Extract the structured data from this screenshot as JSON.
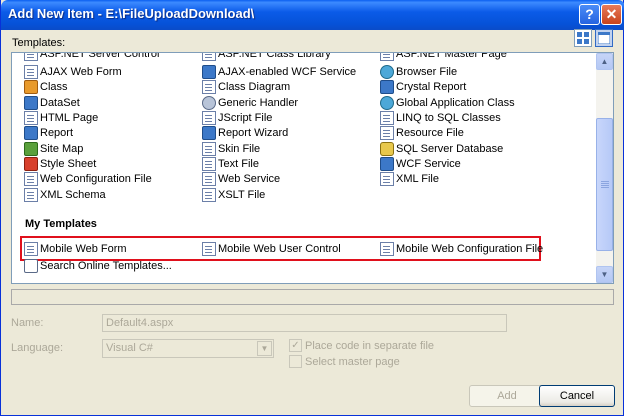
{
  "window": {
    "title": "Add New Item - E:\\FileUploadDownload\\"
  },
  "templates_label": "Templates:",
  "vs_templates": {
    "col1": [
      {
        "label": "ASP.NET Server Control",
        "icon": "page-icon"
      },
      {
        "label": "AJAX Web Form",
        "icon": "ajax-form-icon"
      },
      {
        "label": "Class",
        "icon": "class-icon"
      },
      {
        "label": "DataSet",
        "icon": "dataset-icon"
      },
      {
        "label": "HTML Page",
        "icon": "html-page-icon"
      },
      {
        "label": "Report",
        "icon": "report-icon"
      },
      {
        "label": "Site Map",
        "icon": "sitemap-icon"
      },
      {
        "label": "Style Sheet",
        "icon": "stylesheet-icon"
      },
      {
        "label": "Web Configuration File",
        "icon": "webconfig-icon"
      },
      {
        "label": "XML Schema",
        "icon": "xml-schema-icon"
      }
    ],
    "col2": [
      {
        "label": "ASP.NET Class Library",
        "icon": "page-icon"
      },
      {
        "label": "AJAX-enabled WCF Service",
        "icon": "wcf-icon"
      },
      {
        "label": "Class Diagram",
        "icon": "class-diagram-icon"
      },
      {
        "label": "Generic Handler",
        "icon": "handler-icon"
      },
      {
        "label": "JScript File",
        "icon": "jscript-icon"
      },
      {
        "label": "Report Wizard",
        "icon": "report-wizard-icon"
      },
      {
        "label": "Skin File",
        "icon": "skin-icon"
      },
      {
        "label": "Text File",
        "icon": "text-file-icon"
      },
      {
        "label": "Web Service",
        "icon": "web-service-icon"
      },
      {
        "label": "XSLT File",
        "icon": "xslt-icon"
      }
    ],
    "col3": [
      {
        "label": "ASP.NET Master Page",
        "icon": "page-icon"
      },
      {
        "label": "Browser File",
        "icon": "browser-icon"
      },
      {
        "label": "Crystal Report",
        "icon": "crystal-report-icon"
      },
      {
        "label": "Global Application Class",
        "icon": "global-icon"
      },
      {
        "label": "LINQ to SQL Classes",
        "icon": "linq-icon"
      },
      {
        "label": "Resource File",
        "icon": "resource-icon"
      },
      {
        "label": "SQL Server Database",
        "icon": "database-icon"
      },
      {
        "label": "WCF Service",
        "icon": "wcf-icon"
      },
      {
        "label": "XML File",
        "icon": "xml-file-icon"
      }
    ]
  },
  "my_templates": {
    "heading": "My Templates",
    "items": [
      {
        "label": "Mobile Web Form"
      },
      {
        "label": "Mobile Web User Control"
      },
      {
        "label": "Mobile Web Configuration File"
      }
    ],
    "search": "Search Online Templates..."
  },
  "form": {
    "name_label": "Name:",
    "name_value": "Default4.aspx",
    "language_label": "Language:",
    "language_value": "Visual C#",
    "place_code_label": "Place code in separate file",
    "place_code_checked": true,
    "master_page_label": "Select master page",
    "master_page_checked": false
  },
  "buttons": {
    "add": "Add",
    "cancel": "Cancel"
  }
}
